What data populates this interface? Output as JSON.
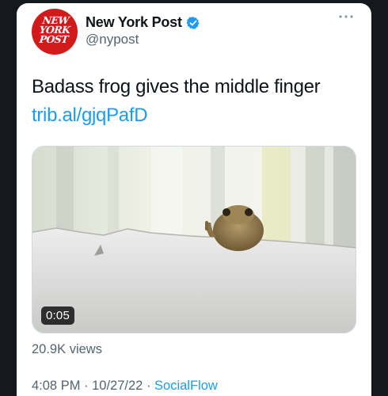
{
  "account": {
    "logo_lines": [
      "NEW",
      "YORK",
      "POST"
    ],
    "name": "New York Post",
    "handle": "@nypost",
    "verified": true
  },
  "tweet": {
    "text": "Badass frog gives the middle finger",
    "link": "trib.al/gjqPafD"
  },
  "media": {
    "duration": "0:05"
  },
  "stats": {
    "views": "20.9K views"
  },
  "meta": {
    "time": "4:08 PM",
    "sep1": " · ",
    "date": "10/27/22",
    "sep2": " · ",
    "source": "SocialFlow"
  },
  "icons": {
    "more": "more-horizontal-icon",
    "verified": "verified-badge-icon"
  },
  "colors": {
    "background": "#15181c",
    "card": "#ffffff",
    "brand_red": "#d11b1b",
    "link_blue": "#1d9bf0",
    "secondary_text": "#536471",
    "primary_text": "#0f1419"
  }
}
